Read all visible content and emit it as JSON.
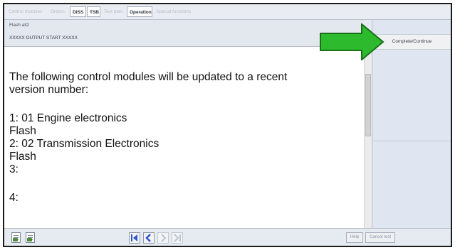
{
  "tabs": [
    {
      "label": "Control modules",
      "selected": false
    },
    {
      "label": "Orders",
      "selected": false
    },
    {
      "label": "DISS",
      "selected": true
    },
    {
      "label": "TSB",
      "selected": true
    },
    {
      "label": "Test plan",
      "selected": false
    },
    {
      "label": "Operation",
      "selected": true
    },
    {
      "label": "Special functions",
      "selected": false
    }
  ],
  "header": {
    "line1": "Flash all2",
    "line2": "XXXXX OUTPUT START XXXXX"
  },
  "main_text": {
    "lines": [
      "The following control modules will be updated to a recent",
      "version number:",
      "",
      "1: 01 Engine electronics",
      "Flash",
      "2: 02 Transmission Electronics",
      "Flash",
      "3:",
      "",
      "4:"
    ]
  },
  "right_panel": {
    "button_label": "Complete/Continue"
  },
  "toolbar": {
    "help_label": "Help",
    "cancel_label": "Cancel test"
  },
  "colors": {
    "arrow_fill": "#2dbb2d",
    "arrow_stroke": "#1a6e1a",
    "nav_active": "#2f56c9"
  },
  "icons": [
    "document-icon",
    "document-icon",
    "first-page-icon",
    "previous-icon",
    "next-icon",
    "last-page-icon"
  ]
}
